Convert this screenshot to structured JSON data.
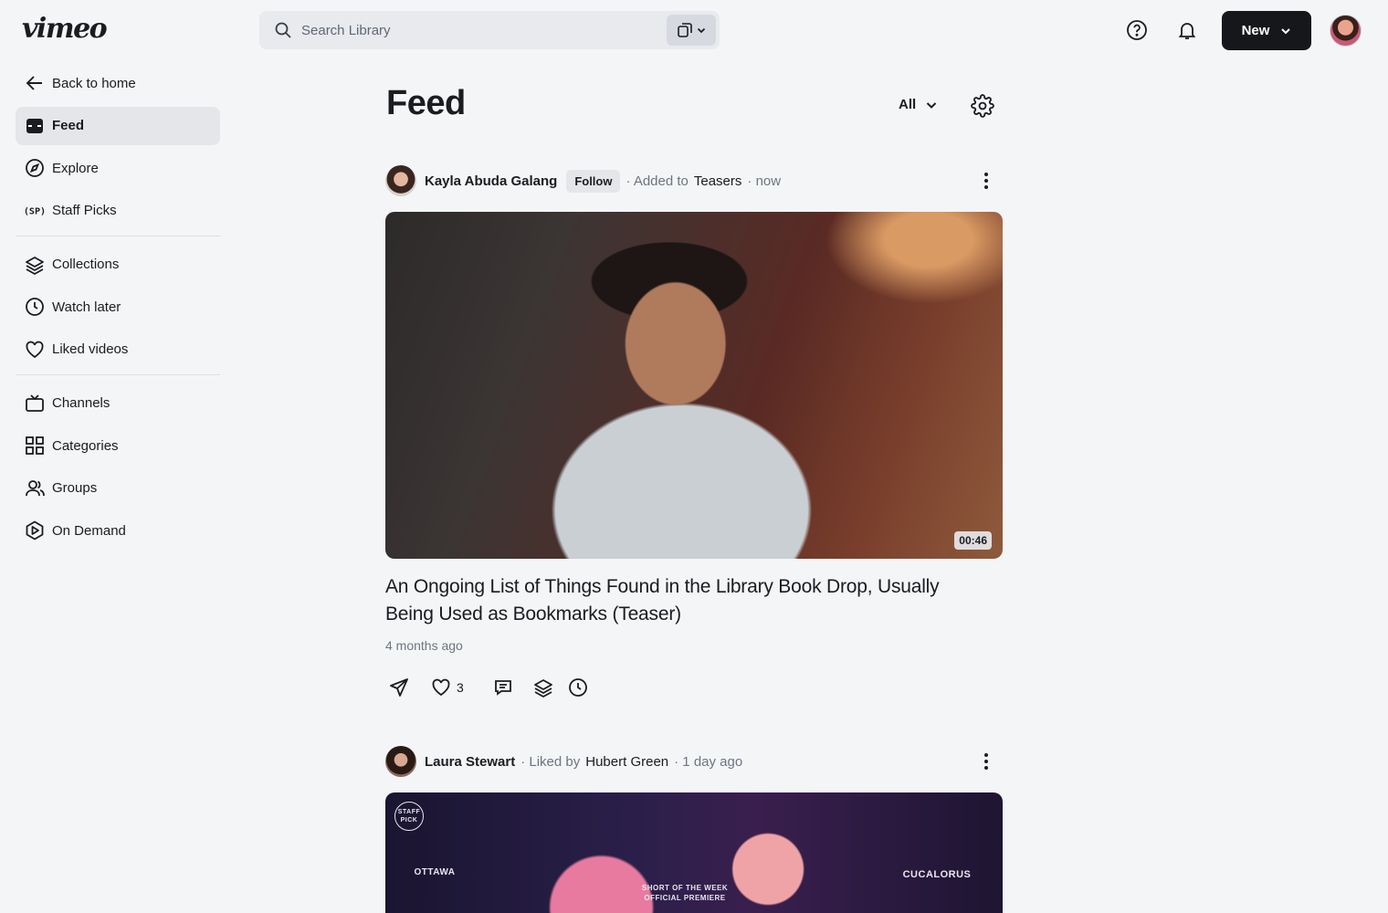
{
  "app": {
    "logo": "vimeo"
  },
  "search": {
    "placeholder": "Search Library"
  },
  "header": {
    "new_label": "New"
  },
  "sidebar": {
    "back_label": "Back to home",
    "items": [
      {
        "label": "Feed",
        "icon": "feed-icon",
        "active": true
      },
      {
        "label": "Explore",
        "icon": "compass-icon"
      },
      {
        "label": "Staff Picks",
        "icon": "staff-picks-icon"
      },
      {
        "label": "Collections",
        "icon": "layers-icon"
      },
      {
        "label": "Watch later",
        "icon": "clock-icon"
      },
      {
        "label": "Liked videos",
        "icon": "heart-icon"
      },
      {
        "label": "Channels",
        "icon": "tv-icon"
      },
      {
        "label": "Categories",
        "icon": "grid-icon"
      },
      {
        "label": "Groups",
        "icon": "users-icon"
      },
      {
        "label": "On Demand",
        "icon": "play-hex-icon"
      }
    ]
  },
  "feed": {
    "title": "Feed",
    "filter_label": "All",
    "posts": [
      {
        "author": "Kayla Abuda Galang",
        "follow_label": "Follow",
        "meta_prefix": "· Added to",
        "meta_target": "Teasers",
        "meta_time": "· now",
        "duration": "00:46",
        "title": "An Ongoing List of Things Found in the Library Book Drop, Usually Being Used as Bookmarks (Teaser)",
        "time_ago": "4 months ago",
        "likes": "3"
      },
      {
        "author": "Laura Stewart",
        "meta_prefix": "· Liked by",
        "meta_target": "Hubert Green",
        "meta_time": "· 1 day ago",
        "badges": {
          "staff_pick": "STAFF PICK",
          "left_laurel": "OTTAWA",
          "center_line1": "SHORT OF THE WEEK",
          "center_line2": "OFFICIAL PREMIERE",
          "right_laurel": "CUCALORUS"
        }
      }
    ]
  }
}
